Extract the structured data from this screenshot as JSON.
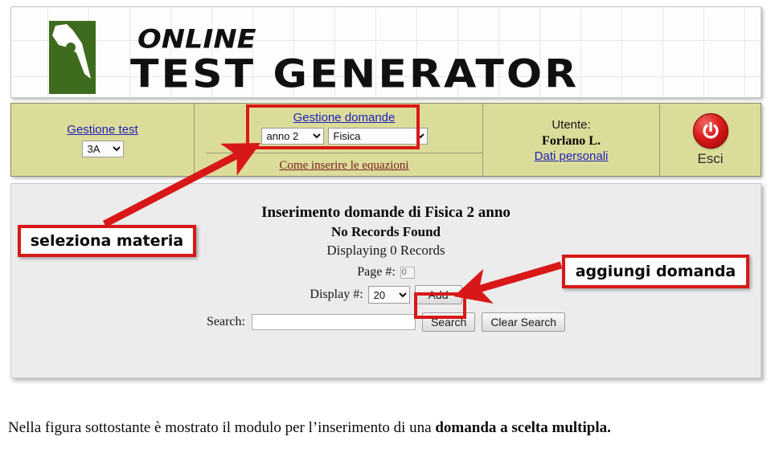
{
  "header": {
    "logo_icon": "pen-nib-icon",
    "wordmark_top": "ONLINE",
    "wordmark_main": "TEST GENERATOR"
  },
  "nav": {
    "gestione_test": {
      "link_label": "Gestione test",
      "classe_selected": "3A",
      "classe_options": [
        "3A"
      ]
    },
    "gestione_domande": {
      "link_label": "Gestione domande",
      "anno_selected": "anno 2",
      "anno_options": [
        "anno 2"
      ],
      "materia_selected": "Fisica",
      "materia_options": [
        "Fisica"
      ],
      "equazioni_link": "Come inserire le equazioni"
    },
    "user": {
      "label": "Utente:",
      "name": "Forlano L.",
      "profile_link": "Dati personali"
    },
    "exit": {
      "icon": "power-icon",
      "label": "Esci"
    }
  },
  "main": {
    "title": "Inserimento domande di Fisica 2 anno",
    "status": "No Records Found",
    "count": "Displaying 0 Records",
    "page_label": "Page #:",
    "page_value": "0",
    "display_label": "Display #:",
    "display_selected": "20",
    "display_options": [
      "20"
    ],
    "add_button": "Add",
    "search_label": "Search:",
    "search_value": "",
    "search_placeholder": "",
    "search_button": "Search",
    "clear_search_button": "Clear Search"
  },
  "annotations": {
    "callout_materia": "seleziona materia",
    "callout_aggiungi": "aggiungi domanda",
    "highlight_color": "#d81818"
  },
  "caption": {
    "text": "Nella figura sottostante è mostrato il modulo per l’inserimento di una ",
    "bold": "domanda a scelta multipla."
  }
}
